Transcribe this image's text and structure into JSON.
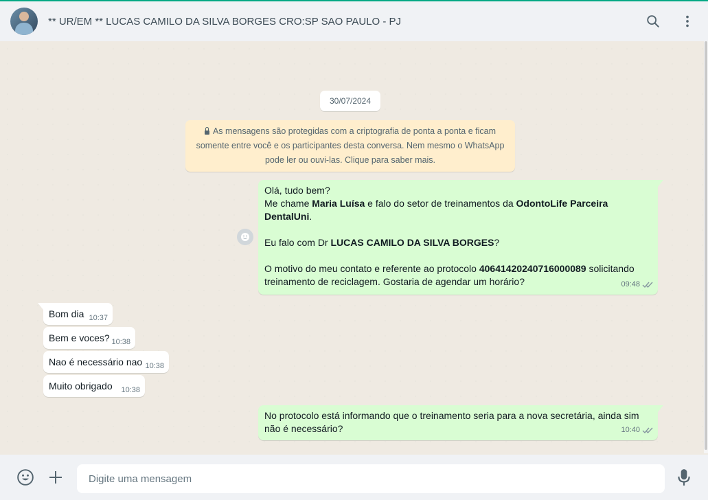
{
  "header": {
    "title": "** UR/EM ** LUCAS CAMILO DA SILVA BORGES CRO:SP SAO PAULO - PJ"
  },
  "chat": {
    "date": "30/07/2024",
    "encryption_notice": {
      "line1": "As mensagens são protegidas com a criptografia de ponta a ponta e ficam",
      "line2": "somente entre você e os participantes desta conversa. Nem mesmo o WhatsApp",
      "line3": "pode ler ou ouvi-las. Clique para saber mais."
    },
    "message1": {
      "line1": "Olá, tudo bem?",
      "l2_a": "Me chame ",
      "l2_b": "Maria Luísa",
      "l2_c": " e falo do setor de treinamentos  da ",
      "l2_d": "OdontoLife Parceira",
      "l3_a": "DentalUni",
      "l3_b": ".",
      "l5_a": " Eu falo com Dr ",
      "l5_b": "LUCAS CAMILO DA SILVA BORGES",
      "l5_c": "?",
      "l7_a": "O motivo do meu contato e referente ao protocolo ",
      "l7_b": "40641420240716000089",
      "l7_c": " solicitando",
      "line8": "treinamento de reciclagem. Gostaria de agendar um horário?",
      "time": "09:48"
    },
    "incoming": [
      {
        "text": "Bom dia",
        "time": "10:37"
      },
      {
        "text": "Bem e voces?",
        "time": "10:38"
      },
      {
        "text": "Nao é necessário nao",
        "time": "10:38"
      },
      {
        "text": "Muito obrigado",
        "time": "10:38"
      }
    ],
    "message2": {
      "line1": "No protocolo está informando que o treinamento seria para a nova secretária, ainda sim",
      "line2": "não é necessário?",
      "time": "10:40"
    }
  },
  "footer": {
    "placeholder": "Digite uma mensagem"
  },
  "icons": {
    "search": "search-icon",
    "menu": "menu-icon",
    "emoji": "emoji-icon",
    "attach": "plus-icon",
    "mic": "mic-icon",
    "lock": "lock-icon",
    "read": "double-check-icon",
    "react": "react-emoji-icon"
  },
  "colors": {
    "accent": "#00a884",
    "outgoing": "#d9fdd3",
    "incoming": "#ffffff",
    "notice": "#ffeecd",
    "read_ticks": "#8696a0"
  }
}
